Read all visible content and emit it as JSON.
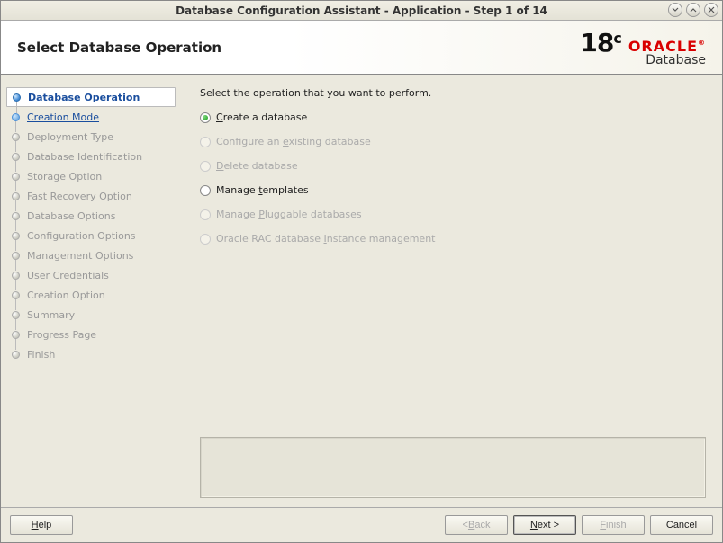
{
  "window": {
    "title": "Database Configuration Assistant - Application - Step 1 of 14"
  },
  "header": {
    "title": "Select Database Operation",
    "logo": {
      "version": "18",
      "sup": "c",
      "brand": "ORACLE",
      "product": "Database"
    }
  },
  "sidebar": {
    "steps": [
      {
        "label": "Database Operation",
        "state": "active"
      },
      {
        "label": "Creation Mode",
        "state": "next"
      },
      {
        "label": "Deployment Type",
        "state": "disabled"
      },
      {
        "label": "Database Identification",
        "state": "disabled"
      },
      {
        "label": "Storage Option",
        "state": "disabled"
      },
      {
        "label": "Fast Recovery Option",
        "state": "disabled"
      },
      {
        "label": "Database Options",
        "state": "disabled"
      },
      {
        "label": "Configuration Options",
        "state": "disabled"
      },
      {
        "label": "Management Options",
        "state": "disabled"
      },
      {
        "label": "User Credentials",
        "state": "disabled"
      },
      {
        "label": "Creation Option",
        "state": "disabled"
      },
      {
        "label": "Summary",
        "state": "disabled"
      },
      {
        "label": "Progress Page",
        "state": "disabled"
      },
      {
        "label": "Finish",
        "state": "disabled"
      }
    ]
  },
  "main": {
    "instruction": "Select the operation that you want to perform.",
    "options": [
      {
        "pre": "",
        "m": "C",
        "post": "reate a database",
        "enabled": true,
        "checked": true
      },
      {
        "pre": "Configure an ",
        "m": "e",
        "post": "xisting database",
        "enabled": false,
        "checked": false
      },
      {
        "pre": "",
        "m": "D",
        "post": "elete database",
        "enabled": false,
        "checked": false
      },
      {
        "pre": "Manage ",
        "m": "t",
        "post": "emplates",
        "enabled": true,
        "checked": false
      },
      {
        "pre": "Manage ",
        "m": "P",
        "post": "luggable databases",
        "enabled": false,
        "checked": false
      },
      {
        "pre": "Oracle RAC database ",
        "m": "I",
        "post": "nstance management",
        "enabled": false,
        "checked": false
      }
    ]
  },
  "footer": {
    "help_pre": "",
    "help_m": "H",
    "help_post": "elp",
    "back_pre": "< ",
    "back_m": "B",
    "back_post": "ack",
    "next_pre": "",
    "next_m": "N",
    "next_post": "ext >",
    "finish_pre": "",
    "finish_m": "F",
    "finish_post": "inish",
    "cancel": "Cancel"
  }
}
